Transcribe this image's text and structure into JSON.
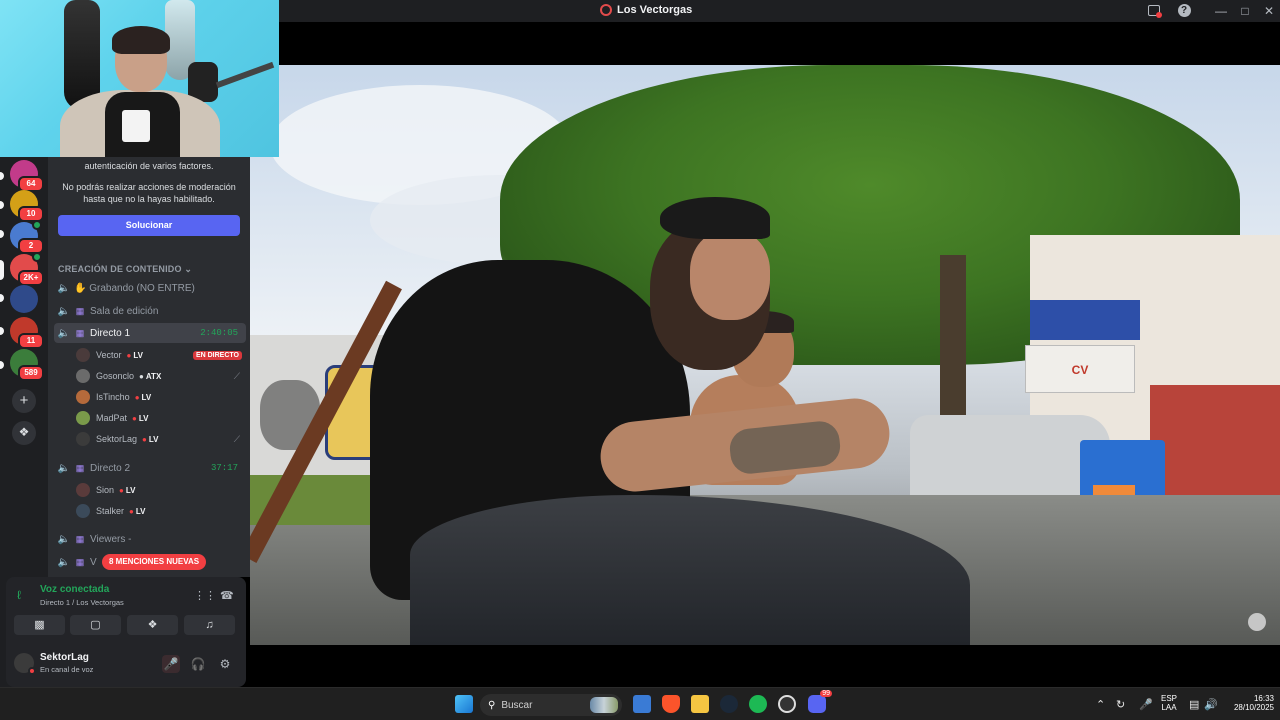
{
  "window": {
    "title": "Los Vectorgas"
  },
  "sidebar": {
    "servers": [
      {
        "name": "server-1",
        "badge": "64",
        "color": "#c23b8a"
      },
      {
        "name": "server-2",
        "badge": "10",
        "color": "#d4a017"
      },
      {
        "name": "server-3",
        "badge": "2",
        "color": "#4a7bd0"
      },
      {
        "name": "server-4",
        "badge": "2K+",
        "color": "#e24b4b"
      },
      {
        "name": "server-5",
        "badge": "",
        "color": "#2f4a8a"
      },
      {
        "name": "server-6",
        "badge": "11",
        "color": "#c0392b"
      },
      {
        "name": "server-7",
        "badge": "589",
        "color": "#3b7d3b"
      }
    ],
    "add_server_icon": "plus-icon",
    "discover_icon": "compass-icon"
  },
  "channels": {
    "mfa_line1": "autenticación de varios factores.",
    "mfa_line2": "No podrás realizar acciones de moderación",
    "mfa_line3": "hasta que no la hayas habilitado.",
    "solve_button": "Solucionar",
    "category": "CREACIÓN DE CONTENIDO",
    "list": [
      {
        "name": "✋ Grabando (NO ENTRE)",
        "timer": ""
      },
      {
        "name": "Sala de edición",
        "timer": ""
      },
      {
        "name": "Directo 1",
        "timer": "2:40:05"
      },
      {
        "name": "Directo 2",
        "timer": "37:17"
      },
      {
        "name": "Viewers -",
        "timer": ""
      },
      {
        "name": "V",
        "timer": ""
      }
    ],
    "directo1_users": [
      {
        "name": "Vector",
        "tag": "LV",
        "badge": "EN DIRECTO",
        "color": "#4a3b3b"
      },
      {
        "name": "Gosonclo",
        "tag": "ATX",
        "badge": "",
        "color": "#6b6b6b"
      },
      {
        "name": "IsTincho",
        "tag": "LV",
        "badge": "",
        "color": "#b56a3b"
      },
      {
        "name": "MadPat",
        "tag": "LV",
        "badge": "",
        "color": "#7a9a4a"
      },
      {
        "name": "SektorLag",
        "tag": "LV",
        "badge": "",
        "color": "#3b3b3b"
      }
    ],
    "directo2_users": [
      {
        "name": "Sion",
        "tag": "LV",
        "color": "#5a3b3b"
      },
      {
        "name": "Stalker",
        "tag": "LV",
        "color": "#3b4a5a"
      }
    ],
    "mentions_pill": "8 MENCIONES NUEVAS"
  },
  "voice": {
    "status": "Voz conectada",
    "channel": "Directo 1 / Los Vectorgas"
  },
  "user_panel": {
    "username": "SektorLag",
    "status": "En canal de voz"
  },
  "taskbar": {
    "search_label": "Buscar",
    "language_top": "ESP",
    "language_bottom": "LAA",
    "time": "16:33",
    "date": "28/10/2025",
    "discord_badge": "99"
  }
}
